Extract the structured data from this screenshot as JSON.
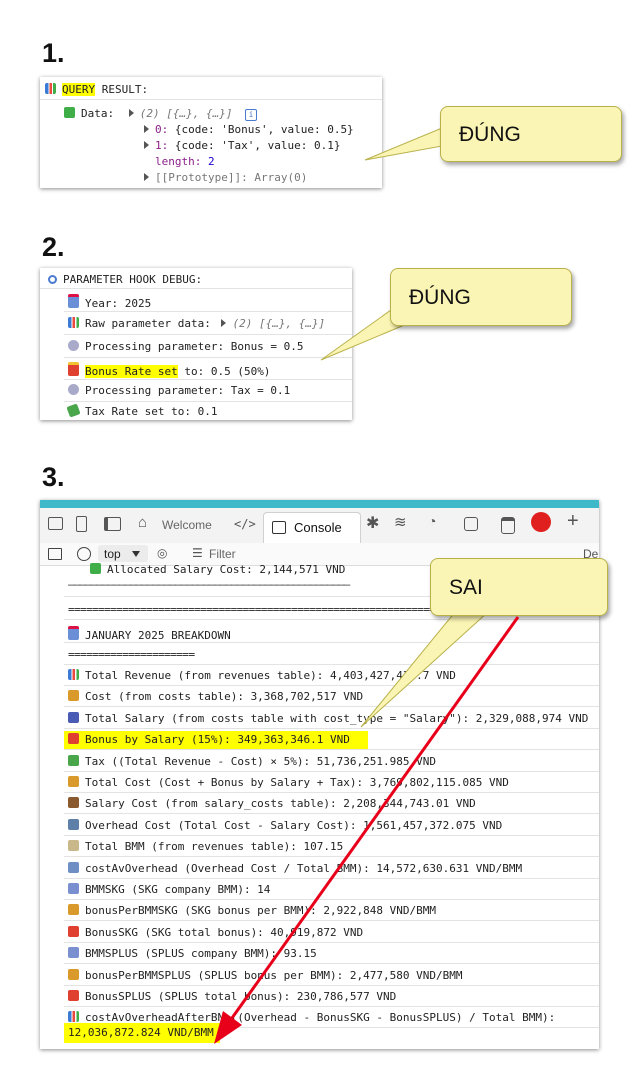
{
  "steps": {
    "s1": "1.",
    "s2": "2.",
    "s3": "3."
  },
  "callouts": {
    "c1": "ĐÚNG",
    "c2": "ĐÚNG",
    "c3": "SAI"
  },
  "panel1": {
    "title_hl": "QUERY",
    "title_rest": " RESULT:",
    "data_label": "Data:",
    "data_summary": "(2) [{…}, {…}]",
    "info": "i",
    "item0_key": "0:",
    "item0_val": "{code: 'Bonus', value: 0.5}",
    "item1_key": "1:",
    "item1_val": "{code: 'Tax', value: 0.1}",
    "length_key": "length:",
    "length_val": "2",
    "proto": "[[Prototype]]: Array(0)"
  },
  "panel2": {
    "title": "PARAMETER HOOK DEBUG:",
    "year": "Year: 2025",
    "raw_label": "Raw parameter data:",
    "raw_val": "(2) [{…}, {…}]",
    "proc1": "Processing parameter: Bonus = 0.5",
    "bonus_hl": "Bonus Rate set",
    "bonus_rest": " to: 0.5 (50%)",
    "proc2": "Processing parameter: Tax = 0.1",
    "taxrate": "Tax Rate set to: 0.1"
  },
  "devtools": {
    "tab_welcome": "Welcome",
    "tab_console": "Console",
    "context": "top",
    "filter": "Filter",
    "right_cut": "De",
    "plus": "+"
  },
  "console": {
    "allocated": "Allocated Salary Cost: 2,144,571 VND",
    "underline": "──────────────────────────────────────────────────",
    "equals": "================================================================",
    "month_header": "JANUARY 2025 BREAKDOWN",
    "short_equals": "=====================",
    "lines": [
      "Total Revenue (from revenues table): 4,403,427,436.7 VND",
      "Cost (from costs table): 3,368,702,517 VND",
      "Total Salary (from costs table with cost_type = \"Salary\"): 2,329,088,974 VND",
      "Bonus by Salary (15%): 349,363,346.1 VND",
      "Tax ((Total Revenue - Cost) × 5%): 51,736,251.985 VND",
      "Total Cost (Cost + Bonus by Salary + Tax): 3,769,802,115.085 VND",
      "Salary Cost (from salary_costs table): 2,208,344,743.01 VND",
      "Overhead Cost (Total Cost - Salary Cost): 1,561,457,372.075 VND",
      "Total BMM (from revenues table): 107.15",
      "costAvOverhead (Overhead Cost / Total BMM): 14,572,630.631 VND/BMM",
      "BMMSKG (SKG company BMM): 14",
      "bonusPerBMMSKG (SKG bonus per BMM): 2,922,848 VND/BMM",
      "BonusSKG (SKG total bonus): 40,919,872 VND",
      "BMMSPLUS (SPLUS company BMM): 93.15",
      "bonusPerBMMSPLUS (SPLUS bonus per BMM): 2,477,580 VND/BMM",
      "BonusSPLUS (SPLUS total bonus): 230,786,577 VND",
      "costAvOverheadAfterBN ((Overhead - BonusSKG - BonusSPLUS) / Total BMM):"
    ],
    "final_value": "12,036,872.824 VND/BMM"
  },
  "colors": {
    "highlight": "#ffff00",
    "callout": "#fbf5b5",
    "arrow": "#e8001a",
    "teal_bar": "#3fb8c9"
  }
}
